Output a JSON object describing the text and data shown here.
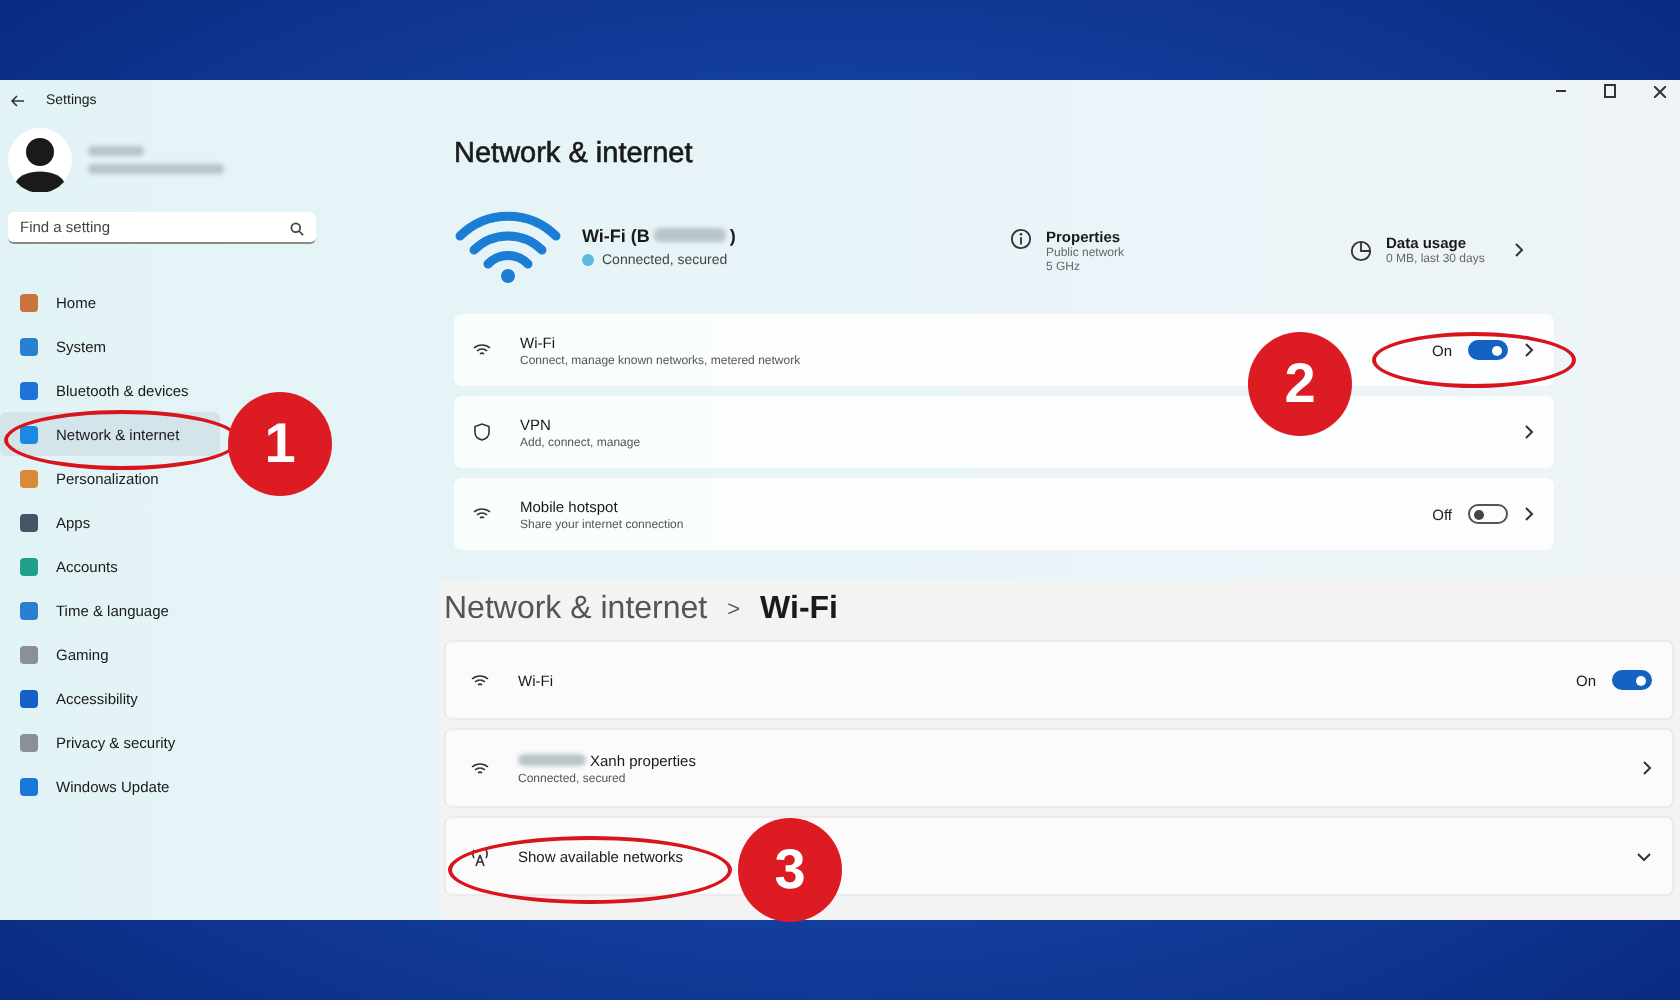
{
  "window": {
    "title": "Settings"
  },
  "search": {
    "placeholder": "Find a setting"
  },
  "nav": [
    {
      "label": "Home",
      "selected": false
    },
    {
      "label": "System",
      "selected": false
    },
    {
      "label": "Bluetooth & devices",
      "selected": false
    },
    {
      "label": "Network & internet",
      "selected": true
    },
    {
      "label": "Personalization",
      "selected": false
    },
    {
      "label": "Apps",
      "selected": false
    },
    {
      "label": "Accounts",
      "selected": false
    },
    {
      "label": "Time & language",
      "selected": false
    },
    {
      "label": "Gaming",
      "selected": false
    },
    {
      "label": "Accessibility",
      "selected": false
    },
    {
      "label": "Privacy & security",
      "selected": false
    },
    {
      "label": "Windows Update",
      "selected": false
    }
  ],
  "page": {
    "title": "Network & internet"
  },
  "connection": {
    "name": "Wi-Fi (B",
    "name_end": ")",
    "status": "Connected, secured"
  },
  "properties": {
    "title": "Properties",
    "lines": [
      "Public network",
      "5 GHz"
    ]
  },
  "data_usage": {
    "title": "Data usage",
    "detail": "0 MB, last 30 days"
  },
  "settings": [
    {
      "kind": "toggle",
      "title": "Wi-Fi",
      "subtitle": "Connect, manage known networks, metered network",
      "state": "On",
      "on": true
    },
    {
      "kind": "link",
      "title": "VPN",
      "subtitle": "Add, connect, manage"
    },
    {
      "kind": "toggle",
      "title": "Mobile hotspot",
      "subtitle": "Share your internet connection",
      "state": "Off",
      "on": false
    }
  ],
  "wifi_page": {
    "breadcrumb": "Network & internet",
    "separator": ">",
    "title": "Wi-Fi",
    "rows": [
      {
        "kind": "toggle",
        "title": "Wi-Fi",
        "state": "On",
        "on": true
      },
      {
        "kind": "link",
        "title": "Xanh properties",
        "subtitle": "Connected, secured"
      },
      {
        "kind": "expand",
        "title": "Show available networks"
      }
    ]
  },
  "annotations": [
    {
      "number": "1"
    },
    {
      "number": "2"
    },
    {
      "number": "3"
    }
  ]
}
